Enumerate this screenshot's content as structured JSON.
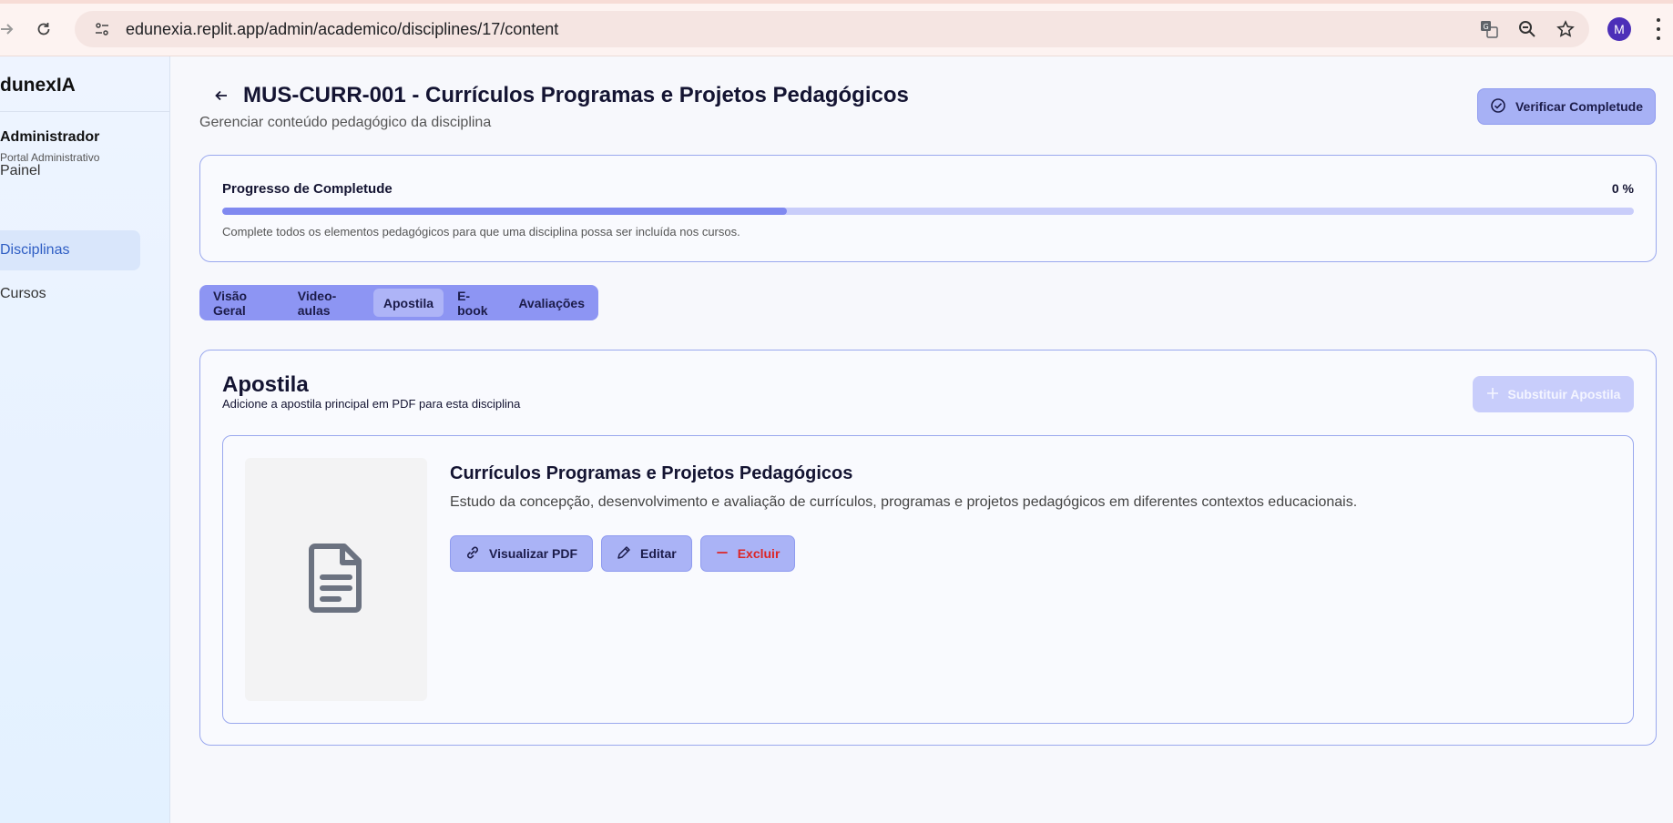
{
  "browser": {
    "url": "edunexia.replit.app/admin/academico/disciplines/17/content",
    "profile_initial": "M"
  },
  "sidebar": {
    "brand": "dunexIA",
    "user_name": "Administrador",
    "user_role": "Portal Administrativo",
    "items": [
      {
        "label": "Painel",
        "active": false
      },
      {
        "label": "Disciplinas",
        "active": true
      },
      {
        "label": "Cursos",
        "active": false
      }
    ]
  },
  "header": {
    "title": "MUS-CURR-001 - Currículos Programas e Projetos Pedagógicos",
    "subtitle": "Gerenciar conteúdo pedagógico da disciplina",
    "verify_button": "Verificar Completude"
  },
  "progress": {
    "title": "Progresso de Completude",
    "value_label": "0 %",
    "fill_fraction": 0.4,
    "hint": "Complete todos os elementos pedagógicos para que uma disciplina possa ser incluída nos cursos."
  },
  "tabs": [
    {
      "label": "Visão Geral",
      "active": false
    },
    {
      "label": "Video-aulas",
      "active": false
    },
    {
      "label": "Apostila",
      "active": true
    },
    {
      "label": "E-book",
      "active": false
    },
    {
      "label": "Avaliações",
      "active": false
    }
  ],
  "apostila": {
    "title": "Apostila",
    "description": "Adicione a apostila principal em PDF para esta disciplina",
    "replace_button": "Substituir Apostila",
    "document": {
      "title": "Currículos Programas e Projetos Pedagógicos",
      "description": "Estudo da concepção, desenvolvimento e avaliação de currículos, programas e projetos pedagógicos em diferentes contextos educacionais.",
      "view_button": "Visualizar PDF",
      "edit_button": "Editar",
      "delete_button": "Excluir"
    }
  },
  "colors": {
    "accent": "#8d95f3",
    "danger": "#dc2626",
    "sidebar_active": "#d9e6fb"
  }
}
